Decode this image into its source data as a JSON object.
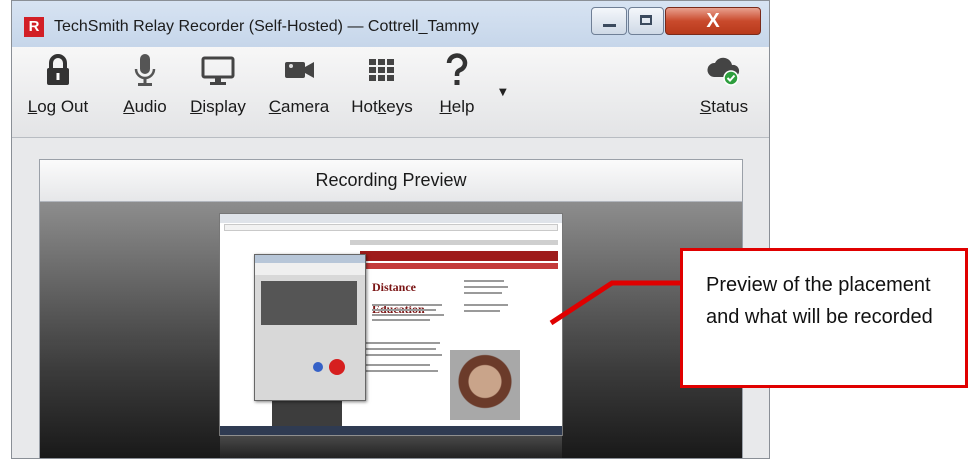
{
  "window": {
    "logo_letter": "R",
    "title": "TechSmith Relay Recorder (Self-Hosted) — Cottrell_Tammy",
    "close_glyph": "X"
  },
  "toolbar": {
    "logout": {
      "pre": "",
      "key": "L",
      "post": "og Out",
      "icon": "lock-icon"
    },
    "audio": {
      "pre": "",
      "key": "A",
      "post": "udio",
      "icon": "microphone-icon"
    },
    "display": {
      "pre": "",
      "key": "D",
      "post": "isplay",
      "icon": "monitor-icon"
    },
    "camera": {
      "pre": "",
      "key": "C",
      "post": "amera",
      "icon": "video-camera-icon"
    },
    "hotkeys": {
      "pre": "Hot",
      "key": "k",
      "post": "eys",
      "icon": "keyboard-icon"
    },
    "help": {
      "pre": "",
      "key": "H",
      "post": "elp",
      "icon": "question-mark-icon"
    },
    "status": {
      "pre": "",
      "key": "S",
      "post": "tatus",
      "icon": "cloud-check-icon"
    }
  },
  "panel": {
    "title": "Recording Preview",
    "mini_logo": "Distance Education"
  },
  "callout": {
    "text": "Preview of the placement and what will be recorded",
    "color": "#e00000"
  }
}
